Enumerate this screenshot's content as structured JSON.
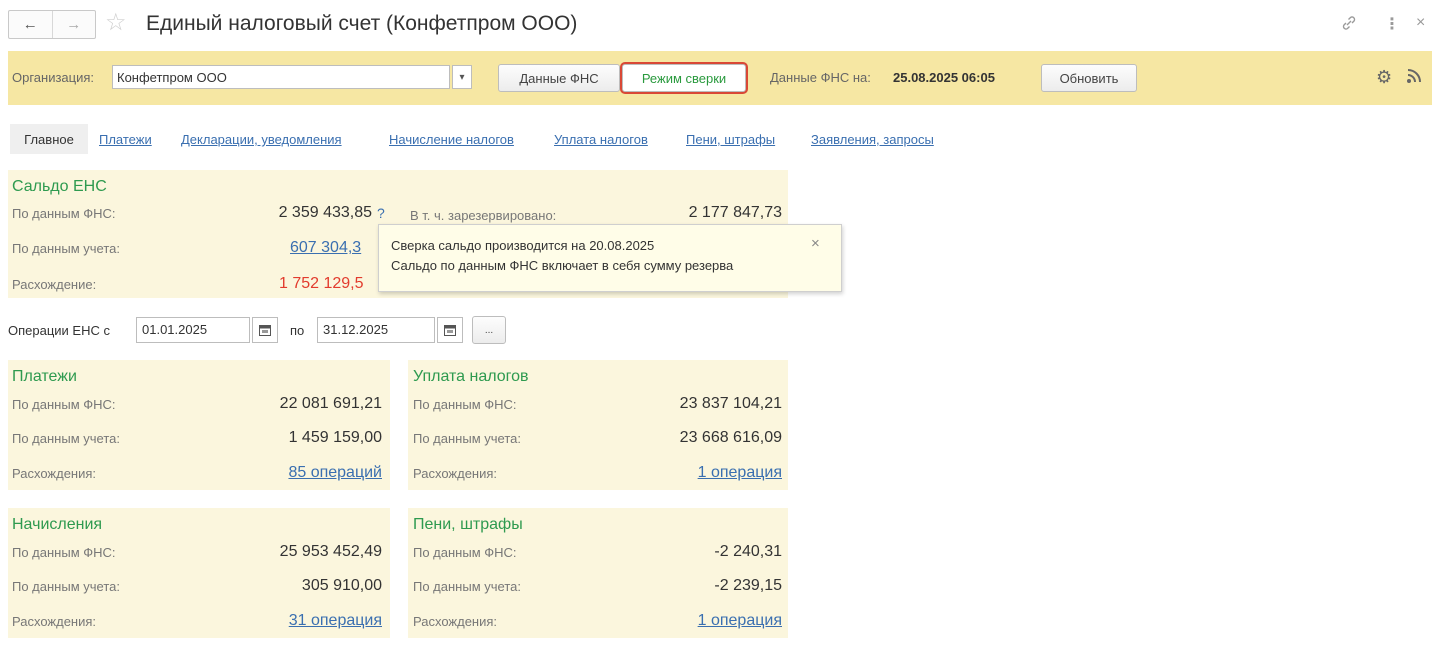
{
  "window": {
    "title": "Единый налоговый счет (Конфетпром ООО)",
    "back_icon": "←",
    "forward_icon": "→",
    "star_icon": "☆",
    "link_icon": "🔗",
    "more_icon": "⋮",
    "close_icon": "×"
  },
  "toolbar": {
    "org_label": "Организация:",
    "org_value": "Конфетпром ООО",
    "dropdown_icon": "▾",
    "fns_data_button": "Данные ФНС",
    "reconcile_button": "Режим сверки",
    "fns_date_label": "Данные ФНС на:",
    "fns_date_value": "25.08.2025 06:05",
    "refresh_button": "Обновить",
    "gear_icon": "⚙",
    "rss_icon": "⦚"
  },
  "tabs": [
    {
      "label": "Главное",
      "active": true
    },
    {
      "label": "Платежи"
    },
    {
      "label": "Декларации, уведомления"
    },
    {
      "label": "Начисление налогов"
    },
    {
      "label": "Уплата налогов"
    },
    {
      "label": "Пени, штрафы"
    },
    {
      "label": "Заявления, запросы"
    }
  ],
  "balance": {
    "title": "Сальдо ЕНС",
    "fns_label": "По данным ФНС:",
    "fns_value": "2 359 433,85",
    "help": "?",
    "reserved_label": "В т. ч. зарезервировано:",
    "reserved_value": "2 177 847,73",
    "acc_label": "По данным учета:",
    "acc_value": "607 304,3",
    "diff_label": "Расхождение:",
    "diff_value": "1 752 129,5"
  },
  "tooltip": {
    "line1": "Сверка сальдо производится на 20.08.2025",
    "line2": "Сальдо по данным ФНС включает в себя сумму резерва",
    "close": "×"
  },
  "period": {
    "label": "Операции ЕНС с",
    "from": "01.01.2025",
    "to_label": "по",
    "to": "31.12.2025",
    "calendar_icon": "▦",
    "more_button": "..."
  },
  "payments": {
    "title": "Платежи",
    "fns_label": "По данным ФНС:",
    "fns_value": "22 081 691,21",
    "acc_label": "По данным учета:",
    "acc_value": "1 459 159,00",
    "diff_label": "Расхождения:",
    "diff_value": "85 операций"
  },
  "tax_payment": {
    "title": "Уплата налогов",
    "fns_label": "По данным ФНС:",
    "fns_value": "23 837 104,21",
    "acc_label": "По данным учета:",
    "acc_value": "23 668 616,09",
    "diff_label": "Расхождения:",
    "diff_value": "1 операция"
  },
  "accruals": {
    "title": "Начисления",
    "fns_label": "По данным ФНС:",
    "fns_value": "25 953 452,49",
    "acc_label": "По данным учета:",
    "acc_value": "305 910,00",
    "diff_label": "Расхождения:",
    "diff_value": "31 операция"
  },
  "penalties": {
    "title": "Пени, штрафы",
    "fns_label": "По данным ФНС:",
    "fns_value": "-2 240,31",
    "acc_label": "По данным учета:",
    "acc_value": "-2 239,15",
    "diff_label": "Расхождения:",
    "diff_value": "1 операция"
  }
}
